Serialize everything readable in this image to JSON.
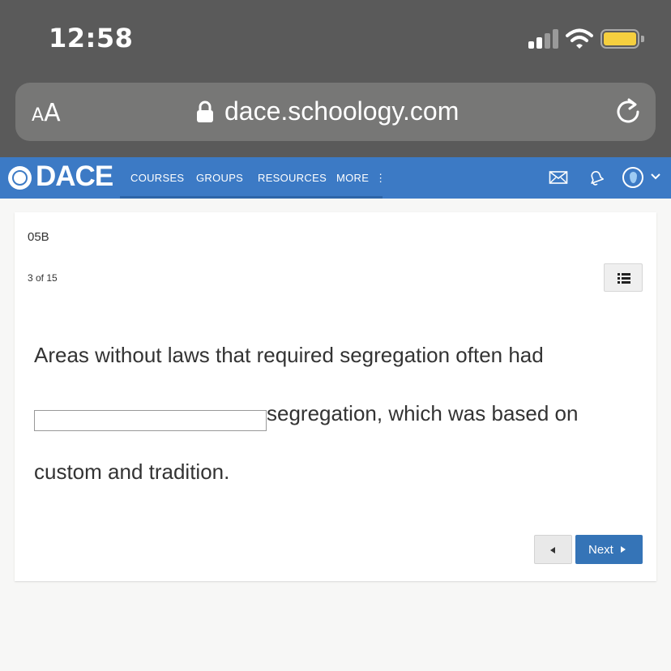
{
  "status_bar": {
    "time": "12:58",
    "signal_bars_active": 2,
    "signal_bars_total": 4,
    "battery_level": 0.85,
    "battery_color": "#f5cf3f"
  },
  "browser": {
    "text_size_label_small": "A",
    "text_size_label_big": "A",
    "url": "dace.schoology.com",
    "icons": [
      "lock-icon",
      "reload-icon"
    ]
  },
  "nav": {
    "logo_text": "DACE",
    "links": [
      "COURSES",
      "GROUPS",
      "RESOURCES",
      "MORE"
    ],
    "more_icon": "⋮",
    "icons": [
      "mail-icon",
      "notification-bell-icon",
      "avatar",
      "chevron-down-icon"
    ],
    "brand_color": "#3c7ac5"
  },
  "assessment": {
    "title": "05B",
    "progress": "3 of 15",
    "question_part1": "Areas without laws that required segregation often had ",
    "answer_value": "",
    "question_part2": "segregation, which was based on custom and tradition.",
    "next_label": "Next"
  }
}
